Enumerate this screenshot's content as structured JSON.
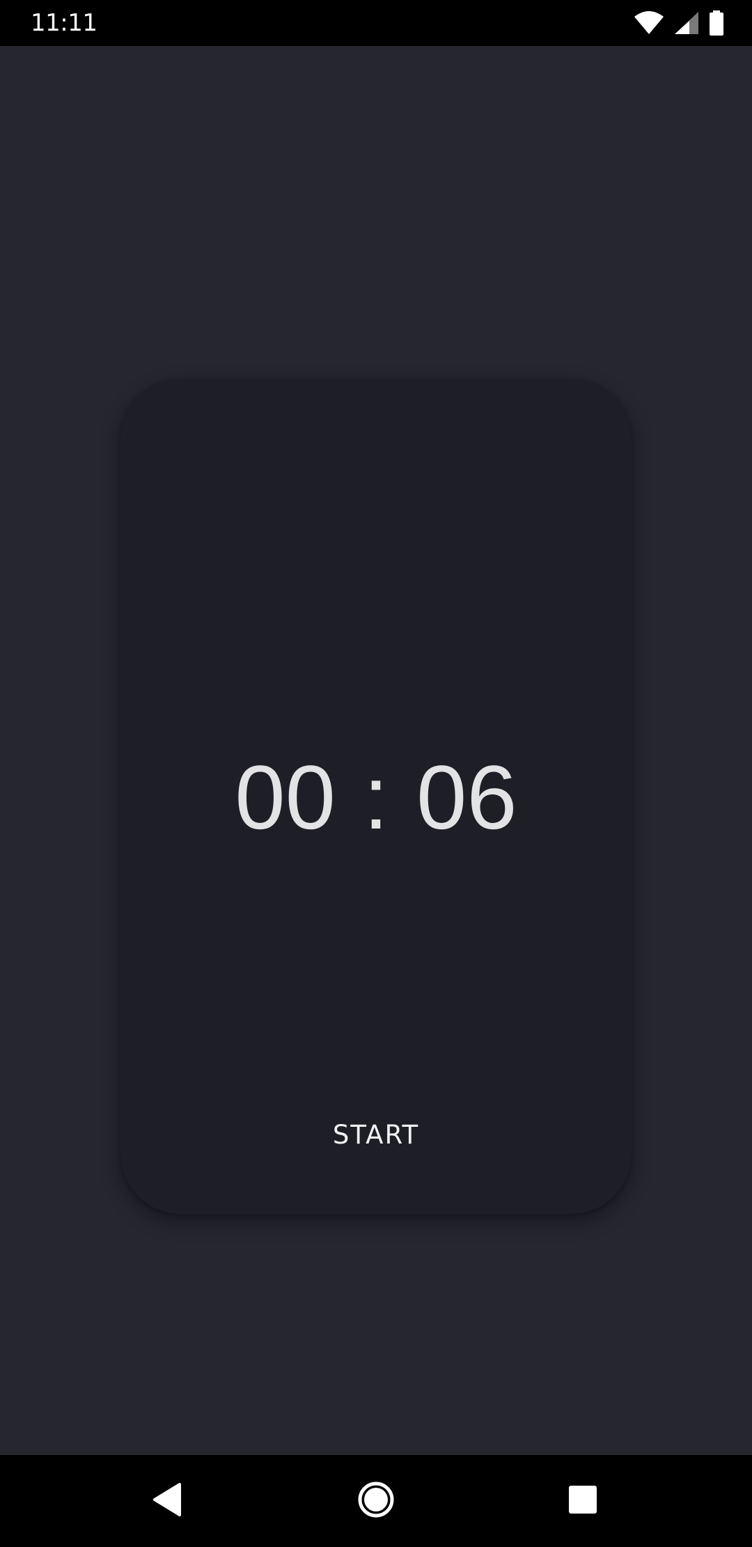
{
  "status_bar": {
    "time": "11:11",
    "icons": [
      "wifi-icon",
      "cellular-signal-icon",
      "battery-icon"
    ]
  },
  "timer": {
    "minutes": "00",
    "separator": ":",
    "seconds": "06",
    "start_label": "START"
  },
  "navigation": {
    "buttons": [
      "back-icon",
      "home-icon",
      "recents-icon"
    ]
  },
  "colors": {
    "background": "#25262e",
    "card": "#1e1f26",
    "timer_text": "#e3e3e6",
    "bars": "#000000"
  }
}
